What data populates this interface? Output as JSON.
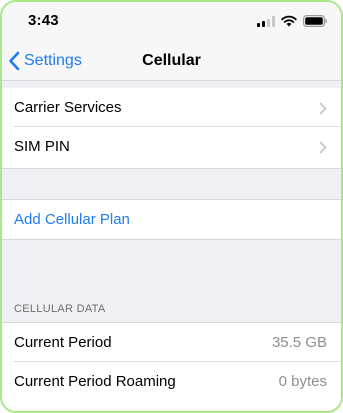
{
  "status_bar": {
    "time": "3:43",
    "icons": [
      "cellular-signal-icon",
      "wifi-icon",
      "battery-icon"
    ]
  },
  "nav": {
    "back_label": "Settings",
    "title": "Cellular"
  },
  "sections": {
    "carrier": {
      "items": [
        {
          "label": "Carrier Services"
        },
        {
          "label": "SIM PIN"
        }
      ]
    },
    "plan": {
      "add_plan_label": "Add Cellular Plan"
    },
    "cellular_data": {
      "header": "CELLULAR DATA",
      "rows": [
        {
          "label": "Current Period",
          "value": "35.5 GB"
        },
        {
          "label": "Current Period Roaming",
          "value": "0 bytes"
        }
      ]
    }
  },
  "colors": {
    "accent": "#1e7cf2",
    "frame": "#a8e888",
    "background": "#efeff4"
  }
}
